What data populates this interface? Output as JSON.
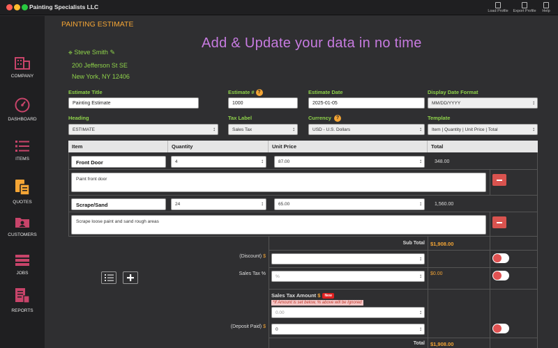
{
  "window": {
    "title": "Painting Specialists LLC"
  },
  "toolbar": {
    "load_profile": "Load Profile",
    "export_profile": "Export Profile",
    "help": "Help"
  },
  "sidebar": {
    "items": [
      {
        "label": "COMPANY",
        "icon": "building-icon"
      },
      {
        "label": "DASHBOARD",
        "icon": "gauge-icon"
      },
      {
        "label": "ITEMS",
        "icon": "list-icon"
      },
      {
        "label": "QUOTES",
        "icon": "quotes-icon"
      },
      {
        "label": "CUSTOMERS",
        "icon": "customers-icon"
      },
      {
        "label": "JOBS",
        "icon": "jobs-icon"
      },
      {
        "label": "REPORTS",
        "icon": "reports-icon"
      }
    ]
  },
  "page": {
    "title": "PAINTING ESTIMATE",
    "hero": "Add & Update your data in no time"
  },
  "sender": {
    "name": "Steve Smith",
    "address1": "200 Jefferson St SE",
    "address2": "New York, NY 12406"
  },
  "form": {
    "estimate_title_label": "Estimate Title",
    "estimate_title_value": "Painting Estimate",
    "estimate_no_label": "Estimate #",
    "estimate_no_value": "1000",
    "estimate_date_label": "Estimate Date",
    "estimate_date_value": "2025-01-05",
    "display_date_format_label": "Display Date Format",
    "display_date_format_value": "MM/DD/YYYY",
    "heading_label": "Heading",
    "heading_value": "ESTIMATE",
    "tax_label_label": "Tax Label",
    "tax_label_value": "Sales Tax",
    "currency_label": "Currency",
    "currency_value": "USD - U.S. Dollars",
    "template_label": "Template",
    "template_value": "Item | Quantity | Unit Price | Total"
  },
  "table": {
    "headers": {
      "item": "Item",
      "quantity": "Quantity",
      "unit_price": "Unit Price",
      "total": "Total"
    },
    "rows": [
      {
        "item": "Front Door",
        "quantity": "4",
        "unit_price": "87.00",
        "total": "348.00",
        "description": "Paint front door"
      },
      {
        "item": "Scrape/Sand",
        "quantity": "24",
        "unit_price": "65.00",
        "total": "1,560.00",
        "description": "Scrape loose paint and sand rough areas"
      }
    ]
  },
  "summary": {
    "subtotal_label": "Sub Total",
    "subtotal_value": "$1,908.00",
    "discount_label": "(Discount)",
    "discount_symbol": "$",
    "sales_tax_pct_label": "Sales Tax %",
    "sales_tax_pct_placeholder": "%",
    "sales_tax_value": "$0.00",
    "sales_tax_amount_label": "Sales Tax Amount",
    "sales_tax_amount_symbol": "$",
    "new_badge": "New",
    "sales_tax_note": "*If Amount is set below, % above will be Ignored",
    "sales_tax_amount_placeholder": "0.00",
    "deposit_label": "(Deposit Paid)",
    "deposit_symbol": "$",
    "deposit_value": "0",
    "total_label": "Total",
    "total_value": "$1,908.00"
  },
  "colors": {
    "accent_orange": "#f4a535",
    "accent_green": "#8fd34a",
    "accent_purple": "#c77be0",
    "sidebar_icon": "#c8446a",
    "delete_red": "#d9534f"
  }
}
